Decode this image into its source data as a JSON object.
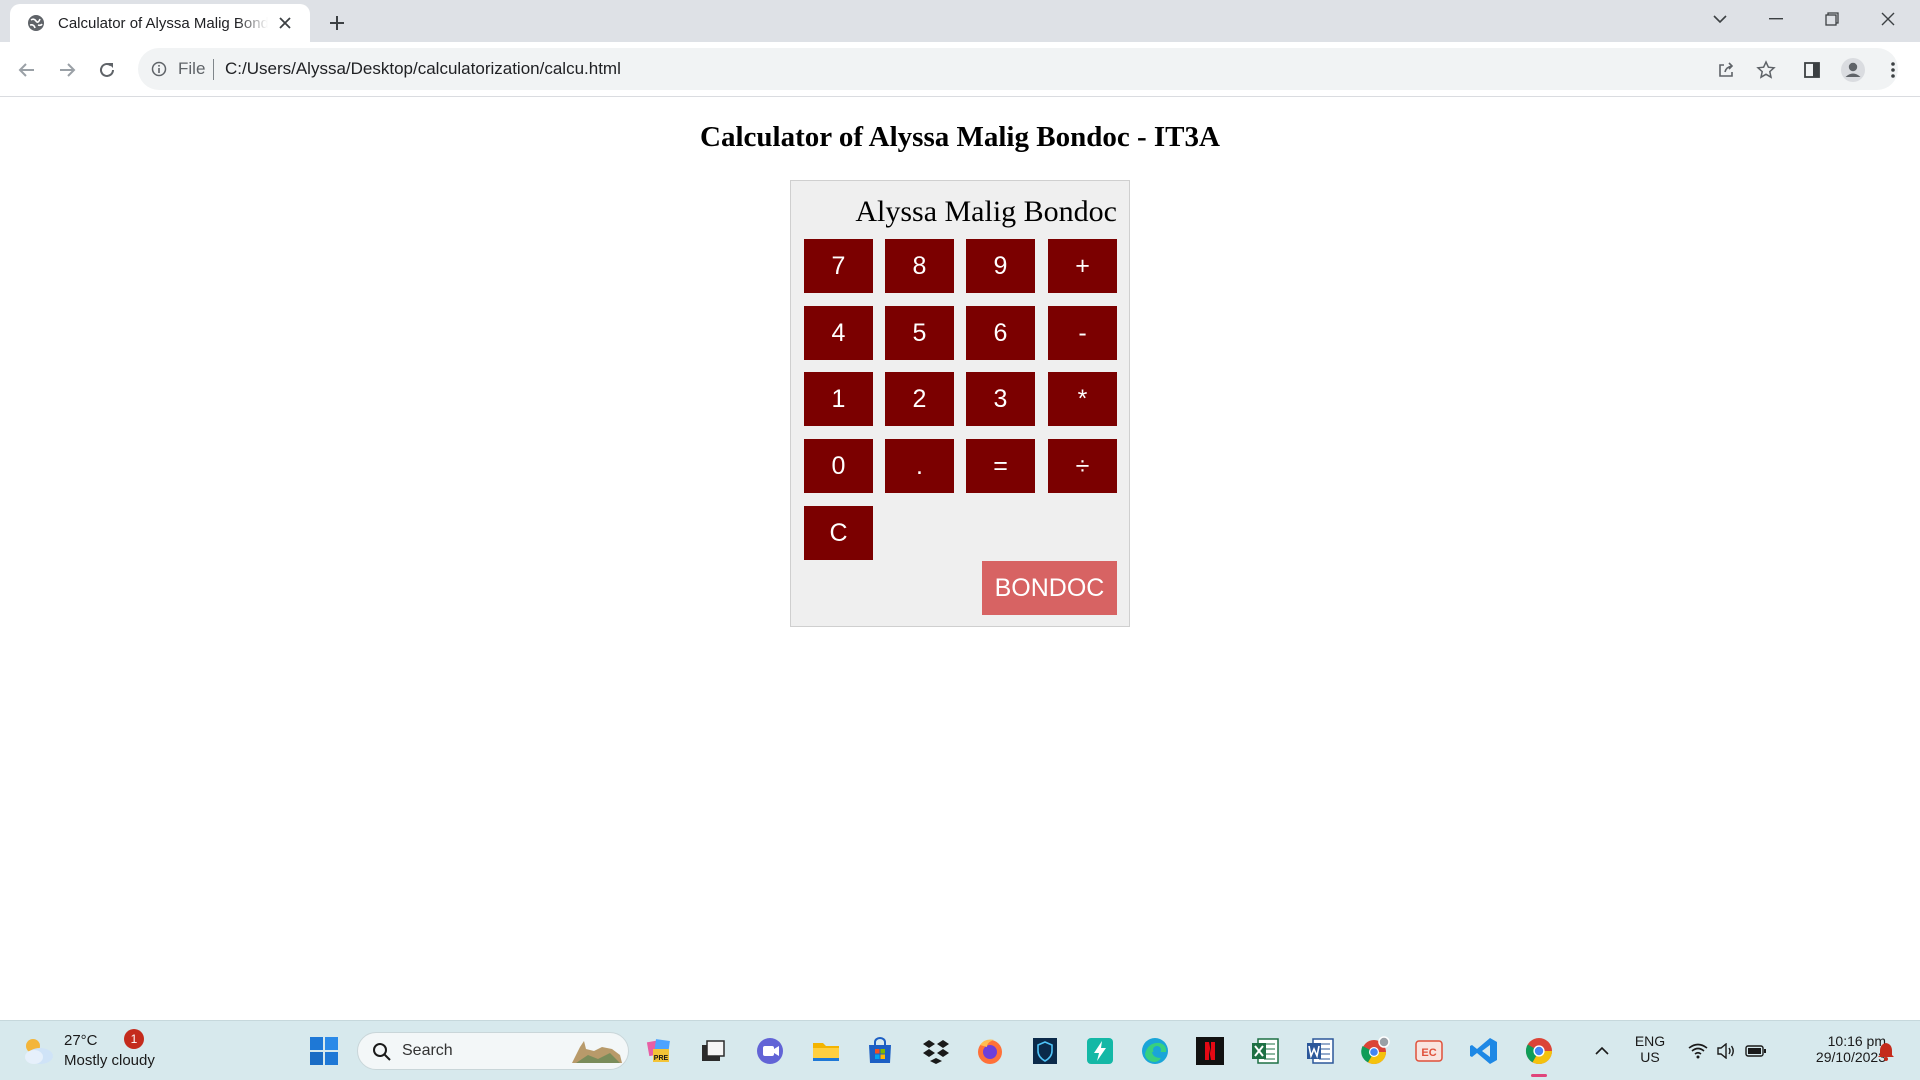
{
  "browser": {
    "tab_title": "Calculator of Alyssa Malig Bondoc",
    "url_scheme": "File",
    "url": "C:/Users/Alyssa/Desktop/calculatorization/calcu.html"
  },
  "page": {
    "title": "Calculator of Alyssa Malig Bondoc - IT3A",
    "display_value": "Alyssa Malig Bondoc",
    "keys": {
      "k7": "7",
      "k8": "8",
      "k9": "9",
      "plus": "+",
      "k4": "4",
      "k5": "5",
      "k6": "6",
      "minus": "-",
      "k1": "1",
      "k2": "2",
      "k3": "3",
      "multiply": "*",
      "k0": "0",
      "dot": ".",
      "equals": "=",
      "divide": "÷",
      "clear": "C"
    },
    "name_button": "BONDOC",
    "colors": {
      "key_bg": "#7b0000",
      "name_button_bg": "#d76363",
      "calculator_bg": "#efefef"
    }
  },
  "taskbar": {
    "weather_temp": "27°C",
    "weather_condition": "Mostly cloudy",
    "weather_badge": "1",
    "search_label": "Search",
    "language_top": "ENG",
    "language_bottom": "US",
    "time": "10:16 pm",
    "date": "29/10/2023"
  }
}
